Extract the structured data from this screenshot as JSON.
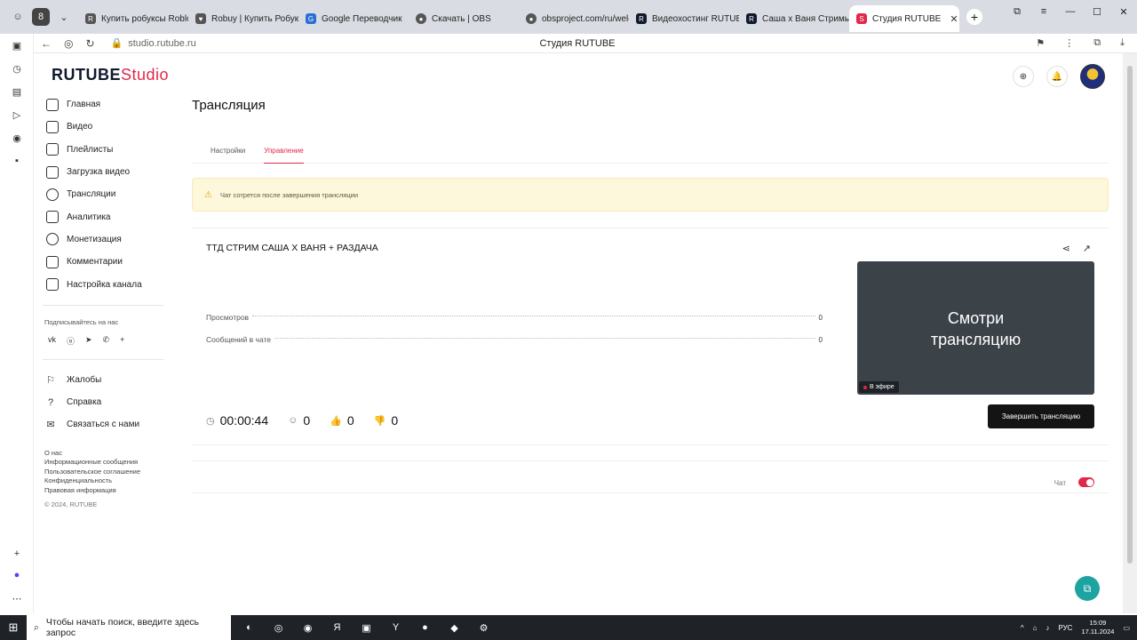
{
  "browser": {
    "tabs": [
      {
        "label": "Купить робуксы Roblox",
        "icon": "page-icon"
      },
      {
        "label": "Robuy | Купить Робукс",
        "icon": "heart-icon"
      },
      {
        "label": "Google Переводчик",
        "icon": "translate-icon"
      },
      {
        "label": "Скачать | OBS",
        "icon": "obs-icon"
      },
      {
        "label": "obsproject.com/ru/welc",
        "icon": "obs-icon"
      },
      {
        "label": "Видеохостинг RUTUBE",
        "icon": "rutube-icon"
      },
      {
        "label": "Саша х Ваня Стримы н",
        "icon": "rutube-icon"
      },
      {
        "label": "Студия RUTUBE",
        "icon": "rutube-studio-icon"
      }
    ],
    "url": "studio.rutube.ru",
    "page_title": "Студия RUTUBE"
  },
  "app": {
    "logo": "RUTUBE",
    "logo_suffix": "Studio"
  },
  "sidebar": {
    "items": [
      {
        "label": "Главная",
        "icon": "home-icon"
      },
      {
        "label": "Видео",
        "icon": "video-icon"
      },
      {
        "label": "Плейлисты",
        "icon": "playlist-icon"
      },
      {
        "label": "Загрузка видео",
        "icon": "upload-icon"
      },
      {
        "label": "Трансляции",
        "icon": "broadcast-icon"
      },
      {
        "label": "Аналитика",
        "icon": "analytics-icon"
      },
      {
        "label": "Монетизация",
        "icon": "money-icon"
      },
      {
        "label": "Комментарии",
        "icon": "comment-icon"
      },
      {
        "label": "Настройка канала",
        "icon": "settings-icon"
      }
    ],
    "subscribe_label": "Подписывайтесь на нас",
    "social": [
      "vk-icon",
      "ok-icon",
      "telegram-icon",
      "viber-icon",
      "plus-icon"
    ],
    "footer_items": [
      {
        "label": "Жалобы",
        "icon": "flag-icon"
      },
      {
        "label": "Справка",
        "icon": "help-icon"
      },
      {
        "label": "Связаться с нами",
        "icon": "mail-icon"
      }
    ],
    "links": [
      "О нас",
      "Информационные сообщения",
      "Пользовательское соглашение",
      "Конфиденциальность",
      "Правовая информация"
    ],
    "copyright": "© 2024, RUTUBE"
  },
  "page": {
    "heading": "Трансляция",
    "tabs": [
      {
        "label": "Настройки",
        "active": false
      },
      {
        "label": "Управление",
        "active": true
      }
    ],
    "warning": "Чат сотрется после завершения трансляции"
  },
  "stream": {
    "title": "ТТД СТРИМ САША Х ВАНЯ + РАЗДАЧА",
    "stats": [
      {
        "label": "Просмотров",
        "value": "0"
      },
      {
        "label": "Сообщений в чате",
        "value": "0"
      }
    ],
    "timer": "00:00:44",
    "viewers": "0",
    "likes": "0",
    "dislikes": "0",
    "preview_text_line1": "Смотри",
    "preview_text_line2": "трансляцию",
    "live_badge": "В эфире",
    "end_button": "Завершить трансляцию"
  },
  "chat": {
    "label": "Чат",
    "enabled": true
  },
  "taskbar": {
    "search_placeholder": "Чтобы начать поиск, введите здесь запрос",
    "language": "РУС",
    "time": "15:09",
    "date": "17.11.2024"
  },
  "colors": {
    "accent": "#e0284a",
    "brand_dark": "#101a2c",
    "live_bg": "#3b4248"
  }
}
